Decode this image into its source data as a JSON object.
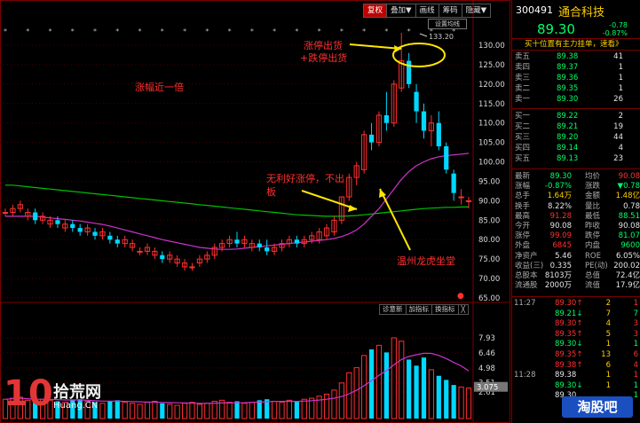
{
  "toolbar": {
    "items": [
      "复权",
      "叠加▼",
      "画线",
      "筹码",
      "隐藏▼"
    ],
    "set_label": "设置均线"
  },
  "chart_data": {
    "type": "candlestick",
    "ylim": [
      63,
      134
    ],
    "y_ticks": [
      "130.00",
      "125.00",
      "120.00",
      "115.00",
      "110.00",
      "105.00",
      "100.00",
      "95.00",
      "90.00",
      "85.00",
      "80.00",
      "75.00",
      "70.00",
      "65.00"
    ],
    "candles": [
      [
        87,
        88,
        86,
        87
      ],
      [
        87,
        89,
        86,
        88
      ],
      [
        88,
        90,
        87,
        89
      ],
      [
        86,
        88,
        85,
        87
      ],
      [
        87,
        88,
        84,
        85
      ],
      [
        85,
        87,
        84,
        86
      ],
      [
        84,
        86,
        83,
        85
      ],
      [
        85,
        86,
        83,
        84
      ],
      [
        83,
        85,
        82,
        84
      ],
      [
        84,
        85,
        82,
        83
      ],
      [
        83,
        84,
        81,
        82
      ],
      [
        82,
        84,
        81,
        83
      ],
      [
        82,
        83,
        80,
        81
      ],
      [
        81,
        83,
        80,
        82
      ],
      [
        81,
        82,
        79,
        80
      ],
      [
        80,
        81,
        78,
        79
      ],
      [
        79,
        81,
        78,
        80
      ],
      [
        78,
        80,
        77,
        79
      ],
      [
        77,
        78,
        76,
        77
      ],
      [
        77,
        79,
        76,
        78
      ],
      [
        76,
        78,
        75,
        77
      ],
      [
        76,
        77,
        74,
        75
      ],
      [
        75,
        77,
        74,
        76
      ],
      [
        74,
        76,
        73,
        75
      ],
      [
        73,
        75,
        72,
        74
      ],
      [
        73,
        74,
        72,
        73
      ],
      [
        74,
        76,
        73,
        75
      ],
      [
        75,
        77,
        74,
        76
      ],
      [
        76,
        79,
        75,
        78
      ],
      [
        78,
        80,
        77,
        79
      ],
      [
        79,
        81,
        78,
        80
      ],
      [
        80,
        82,
        78,
        79
      ],
      [
        79,
        81,
        78,
        80
      ],
      [
        78,
        80,
        77,
        79
      ],
      [
        79,
        80,
        77,
        78
      ],
      [
        78,
        80,
        76,
        77
      ],
      [
        77,
        79,
        76,
        78
      ],
      [
        78,
        80,
        77,
        79
      ],
      [
        79,
        81,
        78,
        80
      ],
      [
        80,
        81,
        78,
        79
      ],
      [
        79,
        81,
        78,
        80
      ],
      [
        80,
        82,
        79,
        81
      ],
      [
        80,
        83,
        79,
        82
      ],
      [
        81,
        84,
        80,
        83
      ],
      [
        82,
        86,
        81,
        85
      ],
      [
        85,
        91,
        84,
        91
      ],
      [
        91,
        97,
        90,
        96
      ],
      [
        96,
        100,
        94,
        99
      ],
      [
        98,
        108,
        97,
        107
      ],
      [
        107,
        110,
        103,
        105
      ],
      [
        105,
        113,
        104,
        112
      ],
      [
        112,
        118,
        108,
        110
      ],
      [
        110,
        121,
        109,
        120
      ],
      [
        119,
        133.2,
        118,
        126
      ],
      [
        126,
        128,
        119,
        120
      ],
      [
        118,
        120,
        110,
        113
      ],
      [
        113,
        115,
        106,
        108
      ],
      [
        108,
        112,
        104,
        110
      ],
      [
        110,
        113,
        103,
        104
      ],
      [
        104,
        105,
        97,
        98
      ],
      [
        97,
        98,
        90,
        92
      ],
      [
        91,
        93,
        89,
        91
      ],
      [
        90,
        91,
        88,
        90
      ]
    ],
    "ma_series": [
      {
        "color": "#00c000",
        "values": [
          94,
          94,
          93.8,
          93.6,
          93.4,
          93.2,
          93,
          92.8,
          92.6,
          92.4,
          92.2,
          92,
          91.8,
          91.6,
          91.4,
          91.2,
          91,
          90.8,
          90.6,
          90.4,
          90.2,
          90,
          89.8,
          89.6,
          89.4,
          89.2,
          89,
          88.8,
          88.6,
          88.4,
          88.2,
          88,
          87.8,
          87.6,
          87.4,
          87.2,
          87,
          86.8,
          86.6,
          86.4,
          86.3,
          86.2,
          86.1,
          86,
          86,
          86,
          86.1,
          86.2,
          86.4,
          86.6,
          86.8,
          87,
          87.2,
          87.4,
          87.6,
          87.8,
          88,
          88.1,
          88.2,
          88.3,
          88.3,
          88.4,
          88.4
        ]
      },
      {
        "color": "#cc33cc",
        "values": [
          86,
          86,
          86,
          86,
          86,
          85.8,
          85.6,
          85.4,
          85.2,
          85,
          84.8,
          84.5,
          84.2,
          83.9,
          83.5,
          83,
          82.5,
          82,
          81.5,
          81,
          80.5,
          80,
          79.6,
          79.2,
          78.8,
          78.4,
          78,
          77.8,
          77.6,
          77.5,
          77.5,
          77.6,
          77.8,
          78,
          78.2,
          78.4,
          78.6,
          78.8,
          79,
          79.2,
          79.4,
          79.6,
          79.8,
          80,
          80.3,
          80.8,
          81.5,
          82.5,
          84,
          86,
          88,
          90.5,
          93,
          95.5,
          97.5,
          99,
          100,
          100.8,
          101.3,
          101.6,
          101.8,
          102,
          102.2
        ]
      }
    ],
    "volume_ticks": [
      "7.93",
      "6.46",
      "4.98",
      "3.51",
      "2.61"
    ],
    "volume": [
      1.9,
      2.0,
      2.1,
      1.8,
      1.7,
      1.9,
      1.8,
      1.7,
      1.6,
      1.8,
      1.9,
      1.7,
      1.6,
      1.5,
      1.7,
      1.8,
      1.6,
      1.5,
      1.4,
      1.6,
      1.7,
      1.5,
      1.4,
      1.3,
      1.5,
      1.6,
      1.4,
      1.5,
      1.7,
      1.8,
      1.6,
      1.7,
      1.5,
      1.6,
      1.8,
      1.9,
      1.7,
      1.6,
      1.8,
      1.7,
      1.9,
      2.0,
      2.2,
      2.4,
      2.8,
      3.5,
      4.5,
      5.0,
      6.2,
      6.8,
      7.2,
      6.5,
      7.93,
      7.6,
      5.8,
      5.2,
      6.0,
      4.8,
      4.2,
      3.8,
      3.3,
      3.1,
      3.0
    ],
    "volume_ma_value": "3.075",
    "annotations": [
      {
        "text": "133.20"
      },
      {
        "text": "涨停出货"
      },
      {
        "text": "+跌停出货"
      },
      {
        "text": "涨幅近一倍"
      },
      {
        "text": "无利好涨停，不出"
      },
      {
        "text": "板"
      },
      {
        "text": "温州龙虎坐堂"
      }
    ]
  },
  "subtabs": [
    "诊意新",
    "加指标",
    "换指标",
    "╳"
  ],
  "quote": {
    "code": "300491",
    "name": "通合科技",
    "price": "89.30",
    "change": "-0.78",
    "change_pct": "-0.87%",
    "message": "买十位置有主力挂单，速看》",
    "sells": [
      {
        "label": "卖五",
        "price": "89.38",
        "vol": "41"
      },
      {
        "label": "卖四",
        "price": "89.37",
        "vol": "1"
      },
      {
        "label": "卖三",
        "price": "89.36",
        "vol": "1"
      },
      {
        "label": "卖二",
        "price": "89.35",
        "vol": "1"
      },
      {
        "label": "卖一",
        "price": "89.30",
        "vol": "26"
      }
    ],
    "buys": [
      {
        "label": "买一",
        "price": "89.22",
        "vol": "2"
      },
      {
        "label": "买二",
        "price": "89.21",
        "vol": "19"
      },
      {
        "label": "买三",
        "price": "89.20",
        "vol": "44"
      },
      {
        "label": "买四",
        "price": "89.14",
        "vol": "4"
      },
      {
        "label": "买五",
        "price": "89.13",
        "vol": "23"
      }
    ],
    "stats": [
      {
        "l1": "最新",
        "v1": "89.30",
        "l2": "均价",
        "v2": "90.08",
        "c1": "g",
        "c2": "r"
      },
      {
        "l1": "涨幅",
        "v1": "-0.87%",
        "l2": "涨跌",
        "v2": "▼0.78",
        "c1": "g",
        "c2": "g"
      },
      {
        "l1": "总手",
        "v1": "1.64万",
        "l2": "金额",
        "v2": "1.48亿",
        "c1": "y",
        "c2": "y"
      },
      {
        "l1": "换手",
        "v1": "8.22%",
        "l2": "量比",
        "v2": "0.78",
        "c1": "w",
        "c2": "w"
      },
      {
        "l1": "最高",
        "v1": "91.28",
        "l2": "最低",
        "v2": "88.51",
        "c1": "r",
        "c2": "g"
      },
      {
        "l1": "今开",
        "v1": "90.08",
        "l2": "昨收",
        "v2": "90.08",
        "c1": "w",
        "c2": "w"
      },
      {
        "l1": "涨停",
        "v1": "99.09",
        "l2": "跌停",
        "v2": "81.07",
        "c1": "r",
        "c2": "g"
      },
      {
        "l1": "外盘",
        "v1": "6845",
        "l2": "内盘",
        "v2": "9600",
        "c1": "r",
        "c2": "g"
      },
      {
        "l1": "净资产",
        "v1": "5.46",
        "l2": "ROE",
        "v2": "6.05%",
        "c1": "w",
        "c2": "w"
      },
      {
        "l1": "收益(三)",
        "v1": "0.335",
        "l2": "PE(动)",
        "v2": "200.02",
        "c1": "w",
        "c2": "w"
      },
      {
        "l1": "总股本",
        "v1": "8103万",
        "l2": "总值",
        "v2": "72.4亿",
        "c1": "w",
        "c2": "w"
      },
      {
        "l1": "流通股",
        "v1": "2000万",
        "l2": "流值",
        "v2": "17.9亿",
        "c1": "w",
        "c2": "w"
      }
    ],
    "ticks": [
      {
        "t": "11:27",
        "p": "89.30↑",
        "v": "2",
        "n": "1",
        "pc": "r",
        "nc": "r"
      },
      {
        "t": "",
        "p": "89.21↓",
        "v": "7",
        "n": "7",
        "pc": "g",
        "nc": "g"
      },
      {
        "t": "",
        "p": "89.30↑",
        "v": "4",
        "n": "3",
        "pc": "r",
        "nc": "r"
      },
      {
        "t": "",
        "p": "89.35↑",
        "v": "5",
        "n": "3",
        "pc": "r",
        "nc": "r"
      },
      {
        "t": "",
        "p": "89.30↓",
        "v": "1",
        "n": "1",
        "pc": "g",
        "nc": "g"
      },
      {
        "t": "",
        "p": "89.35↑",
        "v": "13",
        "n": "6",
        "pc": "r",
        "nc": "r"
      },
      {
        "t": "",
        "p": "89.38↑",
        "v": "6",
        "n": "4",
        "pc": "r",
        "nc": "r"
      },
      {
        "t": "11:28",
        "p": "89.38",
        "v": "1",
        "n": "1",
        "pc": "w",
        "nc": "r"
      },
      {
        "t": "",
        "p": "89.30↓",
        "v": "1",
        "n": "1",
        "pc": "g",
        "nc": "g"
      },
      {
        "t": "",
        "p": "89.30",
        "v": "",
        "n": "1",
        "pc": "w",
        "nc": "g"
      }
    ]
  },
  "watermark": {
    "logo_num": "10",
    "logo_text": "拾荒网",
    "logo_url": "Huang.CN",
    "stamp": "淘股吧"
  }
}
